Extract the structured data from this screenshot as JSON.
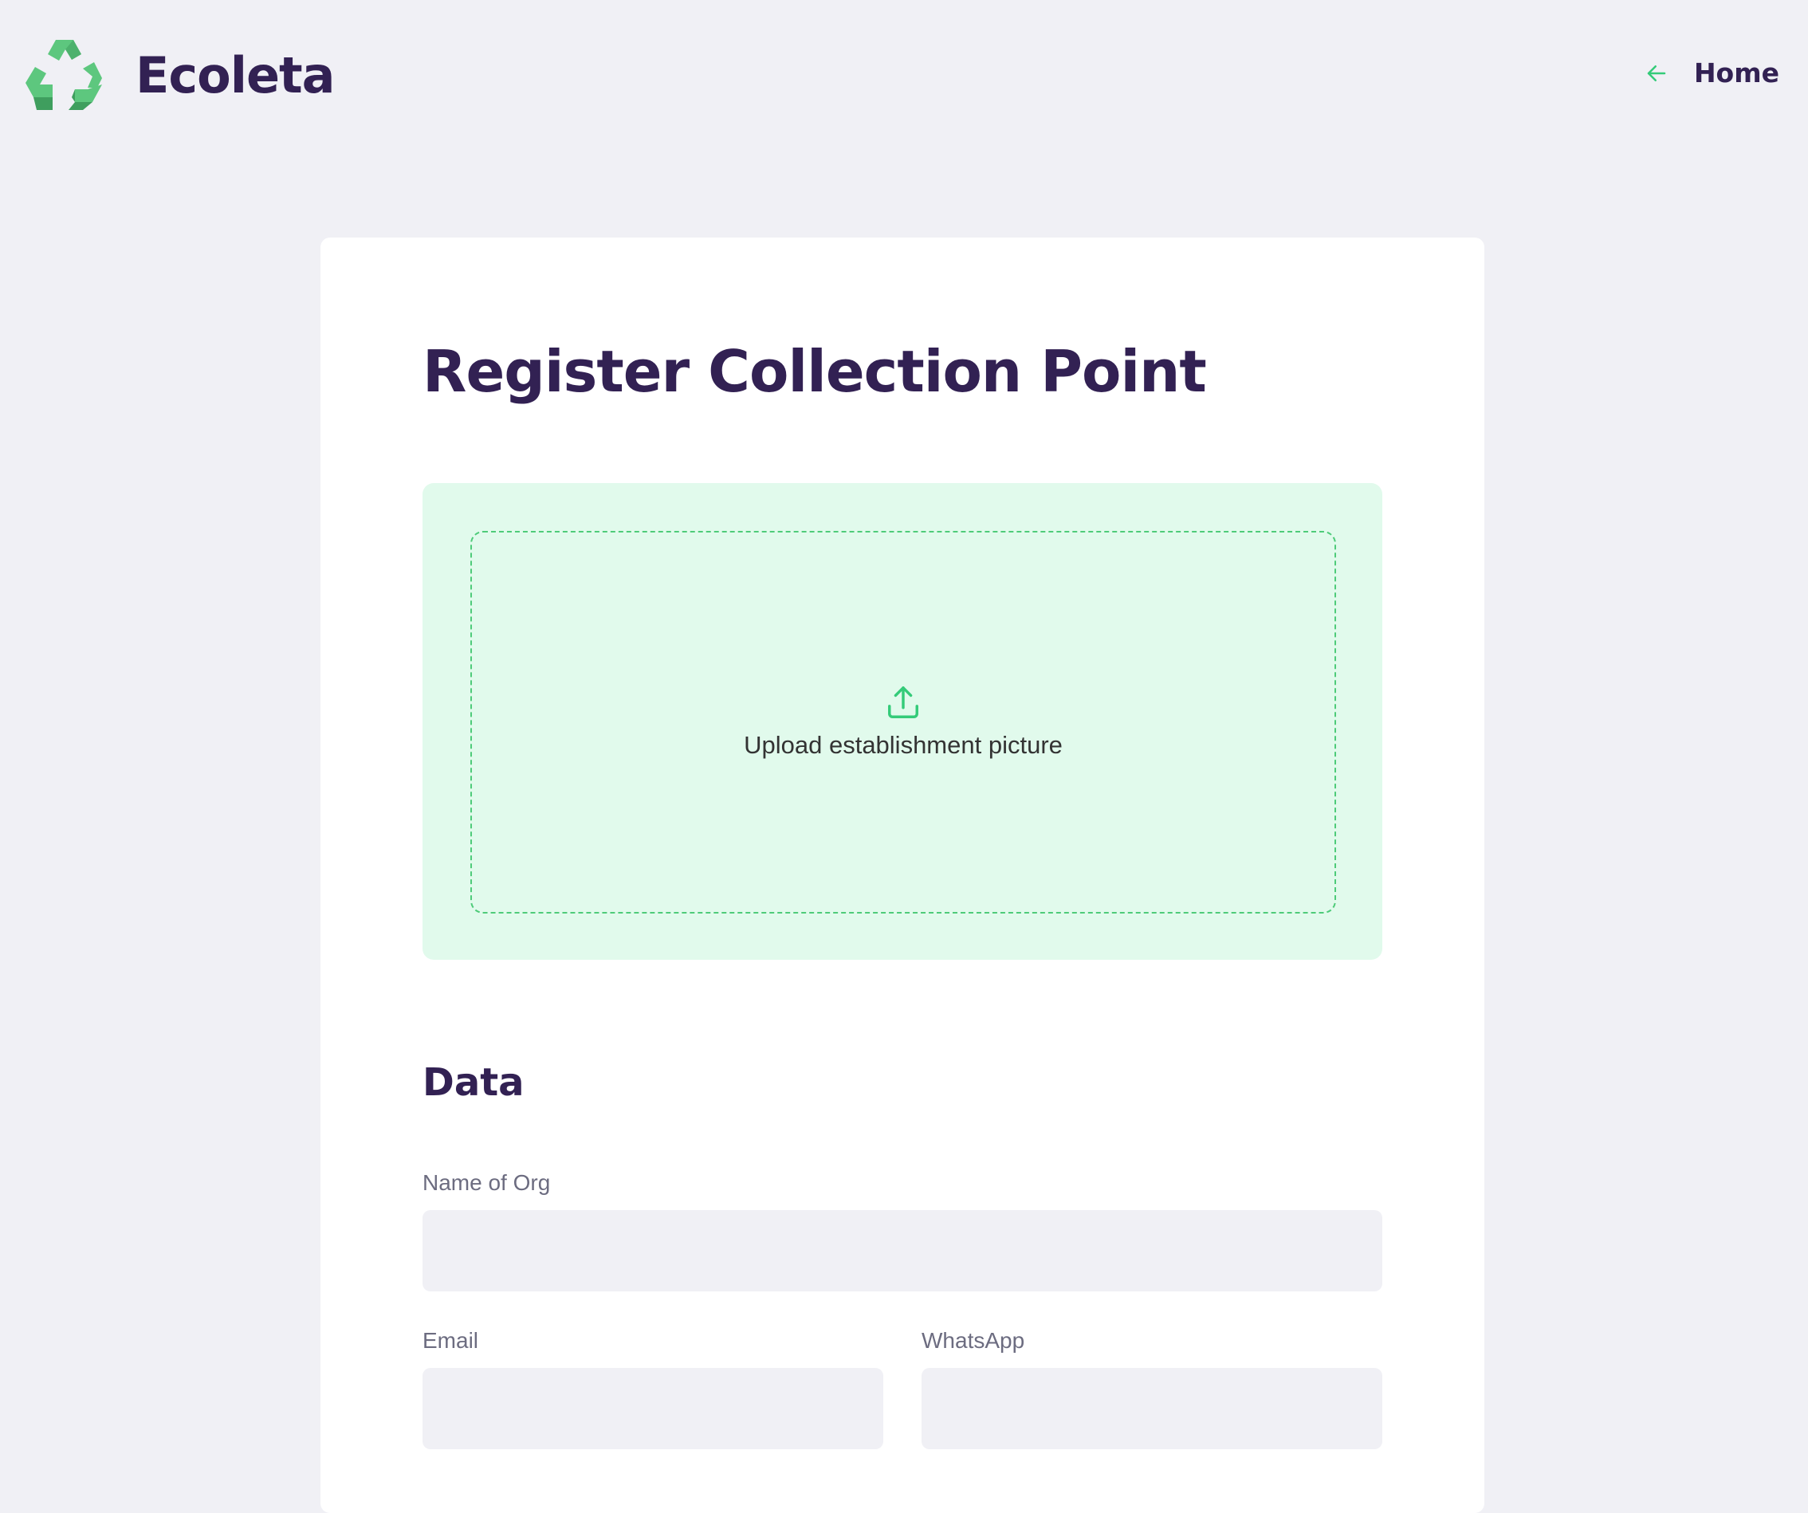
{
  "app": {
    "name": "Ecoleta",
    "logo_icon": "recycle-icon"
  },
  "header": {
    "home_link": {
      "label": "Home",
      "icon": "arrow-left-icon"
    }
  },
  "main": {
    "title": "Register Collection Point",
    "upload": {
      "label": "Upload establishment picture",
      "icon": "upload-icon"
    },
    "section_data": {
      "title": "Data",
      "fields": {
        "name": {
          "label": "Name of Org",
          "value": ""
        },
        "email": {
          "label": "Email",
          "value": ""
        },
        "whatsapp": {
          "label": "WhatsApp",
          "value": ""
        }
      }
    }
  },
  "colors": {
    "background": "#F0F0F5",
    "title": "#322153",
    "accent": "#34CB79",
    "dropzone_bg": "#E1FAEC",
    "input_bg": "#F0F0F5",
    "label": "#6C6C80"
  }
}
